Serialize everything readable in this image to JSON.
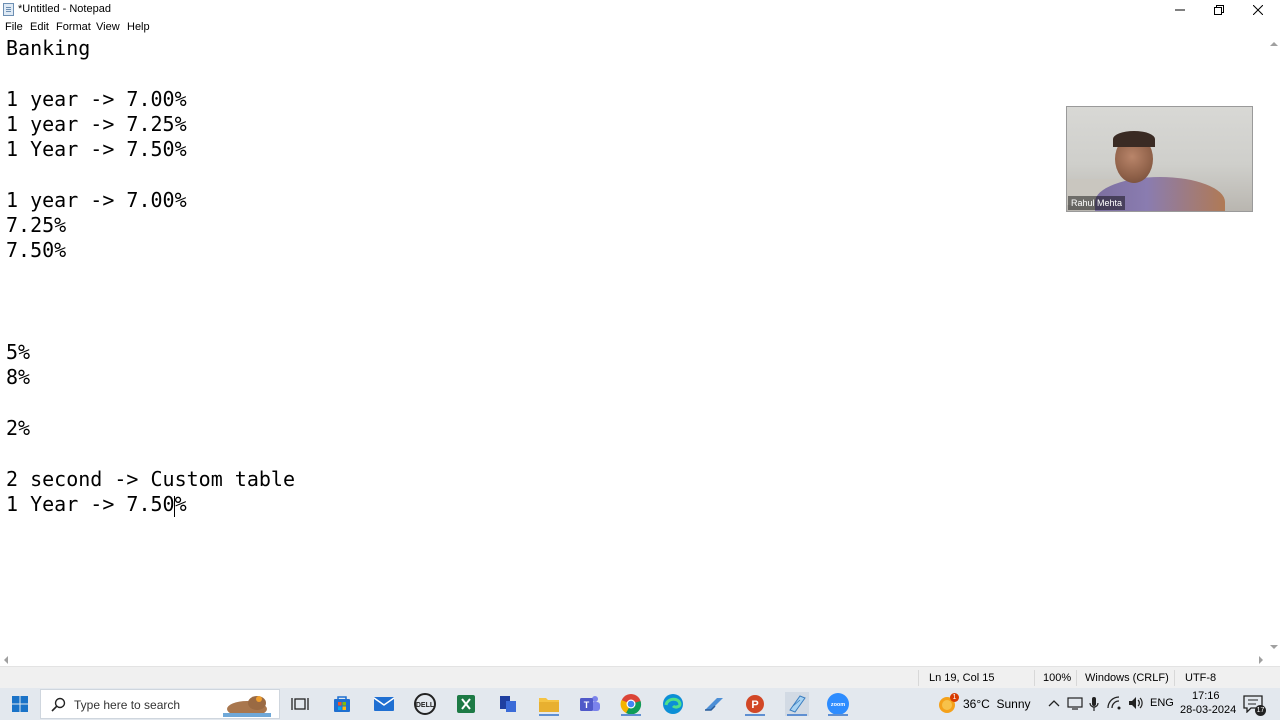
{
  "window": {
    "title": "*Untitled - Notepad"
  },
  "menu": [
    "File",
    "Edit",
    "Format",
    "View",
    "Help"
  ],
  "editor": {
    "lines": [
      "Banking",
      "",
      "1 year -> 7.00%",
      "1 year -> 7.25%",
      "1 Year -> 7.50%",
      "",
      "1 year -> 7.00%",
      "7.25%",
      "7.50%",
      "",
      "",
      "",
      "5%",
      "8%",
      "",
      "2%",
      "",
      "2 second -> Custom table",
      "1 Year -> 7.50%"
    ]
  },
  "statusbar": {
    "position": "Ln 19, Col 15",
    "zoom": "100%",
    "line_ending": "Windows (CRLF)",
    "encoding": "UTF-8"
  },
  "video": {
    "participant_name": "Rahul Mehta"
  },
  "taskbar": {
    "search_placeholder": "Type here to search",
    "weather": "36°C  Sunny",
    "weather_badge": "1",
    "language": "ENG",
    "time": "17:16",
    "date": "28-03-2024",
    "notification_count": "17",
    "apps": [
      "task-view-icon",
      "store-icon",
      "mail-icon",
      "dell-icon",
      "excel-icon",
      "app-icon",
      "file-explorer-icon",
      "teams-icon",
      "chrome-icon",
      "edge-icon",
      "toolbox-icon",
      "powerpoint-icon",
      "notepad-icon",
      "zoom-icon"
    ]
  },
  "colors": {
    "accent": "#5f8fd1",
    "taskbar": "#e3e8ee",
    "statusbar": "#f0f0f0"
  }
}
